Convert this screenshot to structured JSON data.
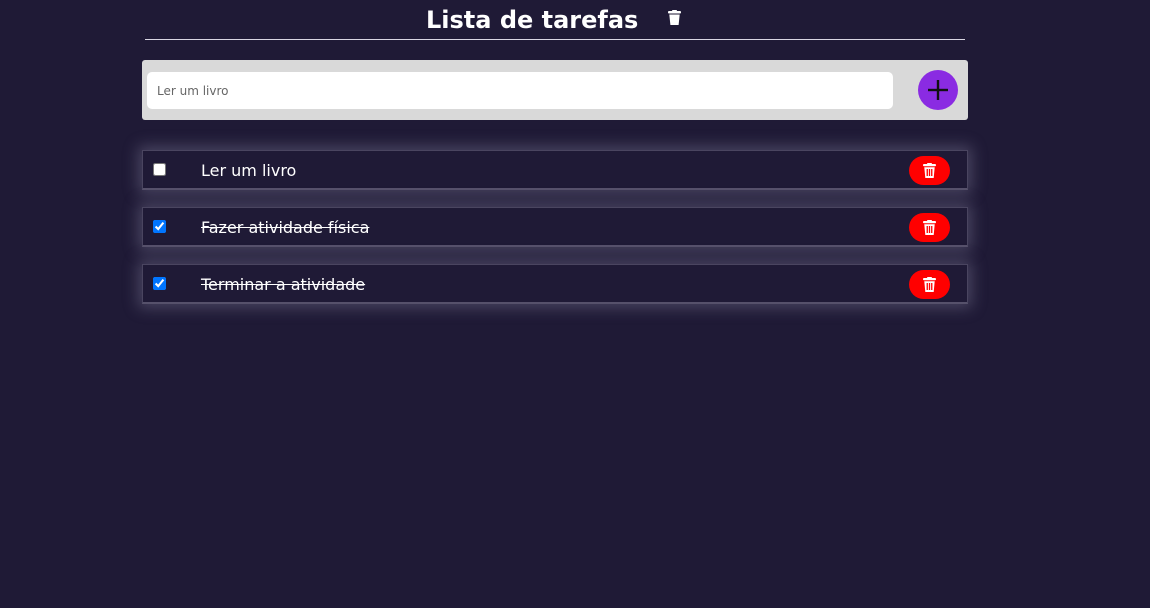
{
  "header": {
    "title": "Lista de tarefas",
    "clear_icon": "trash-icon"
  },
  "add_bar": {
    "input_value": "",
    "input_placeholder": "Ler um livro",
    "add_icon": "plus-icon"
  },
  "tasks": [
    {
      "text": "Ler um livro",
      "completed": false
    },
    {
      "text": "Fazer atividade física",
      "completed": true
    },
    {
      "text": "Terminar a atividade",
      "completed": true
    }
  ],
  "colors": {
    "background": "#1f1a36",
    "add_button": "#8a2be2",
    "delete_button": "#ff0000",
    "input_bar": "#d9d9d9"
  },
  "icons": {
    "delete": "trash-icon"
  }
}
